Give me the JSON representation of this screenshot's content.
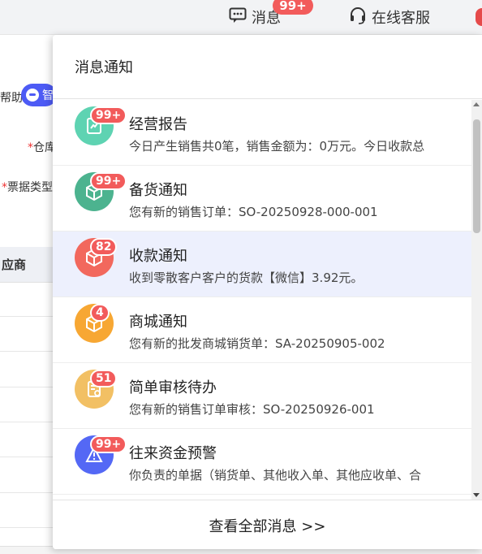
{
  "topbar": {
    "messages_label": "消息",
    "messages_badge": "99+",
    "service_label": "在线客服"
  },
  "background": {
    "help_text": "帮助",
    "help_chip_text": "智",
    "warehouse_req": "*",
    "warehouse_label": "仓库",
    "ticket_req": "*",
    "ticket_label": "票据类型",
    "table_header": "应商"
  },
  "panel": {
    "title": "消息通知",
    "footer_link": "查看全部消息 >>",
    "items": [
      {
        "title": "经营报告",
        "badge": "99+",
        "desc": "今日产生销售共0笔，销售金额为：0万元。今日收款总",
        "icon": "report-icon",
        "color": "#5ed3b2"
      },
      {
        "title": "备货通知",
        "badge": "99+",
        "desc": "您有新的销售订单：SO-20250928-000-001",
        "icon": "box-icon",
        "color": "#4cb38f"
      },
      {
        "title": "收款通知",
        "badge": "82",
        "desc": "收到零散客户客户的货款【微信】3.92元。",
        "icon": "package-icon",
        "color": "#f2685d"
      },
      {
        "title": "商城通知",
        "badge": "4",
        "desc": "您有新的批发商城销货单：SA-20250905-002",
        "icon": "package-icon",
        "color": "#f7a733"
      },
      {
        "title": "简单审核待办",
        "badge": "51",
        "desc": "您有新的销售订单审核：SO-20250926-001",
        "icon": "audit-icon",
        "color": "#f2c064"
      },
      {
        "title": "往来资金预警",
        "badge": "99+",
        "desc": "你负责的单据（销货单、其他收入单、其他应收单、合",
        "icon": "alert-icon",
        "color": "#5468f5"
      }
    ]
  },
  "colors": {
    "accent": "#4d5bf5",
    "badge": "#f25b5b",
    "active_row": "#edf0fd"
  }
}
